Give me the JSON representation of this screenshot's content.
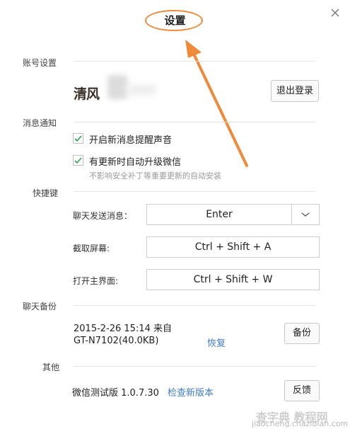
{
  "dialog": {
    "title": "设置",
    "accent_color": "#f0893a"
  },
  "account": {
    "section_label": "账号设置",
    "logo_text": "清风",
    "logout_label": "退出登录"
  },
  "notifications": {
    "section_label": "消息通知",
    "options": [
      {
        "label": "开启新消息提醒声音",
        "checked": true
      },
      {
        "label": "有更新时自动升级微信",
        "checked": true
      }
    ],
    "hint": "不影响安全补丁等重要更新的自动安装"
  },
  "shortcuts": {
    "section_label": "快捷键",
    "rows": [
      {
        "label": "聊天发送消息：",
        "value": "Enter"
      },
      {
        "label": "截取屏幕:",
        "value": "Ctrl + Shift + A"
      },
      {
        "label": "打开主界面:",
        "value": "Ctrl + Shift + W"
      }
    ]
  },
  "backup": {
    "section_label": "聊天备份",
    "line1": "2015-2-26 15:14 来自",
    "line2": "GT-N7102(40.0KB)",
    "restore_label": "恢复",
    "backup_label": "备份"
  },
  "other": {
    "section_label": "其他",
    "version_text": "微信测试版 1.0.7.30",
    "check_update_label": "检查新版本",
    "feedback_label": "反馈"
  },
  "watermark": {
    "text_big": "查字典 教程网",
    "text_small": "jiaocheng.chazidian.com"
  }
}
